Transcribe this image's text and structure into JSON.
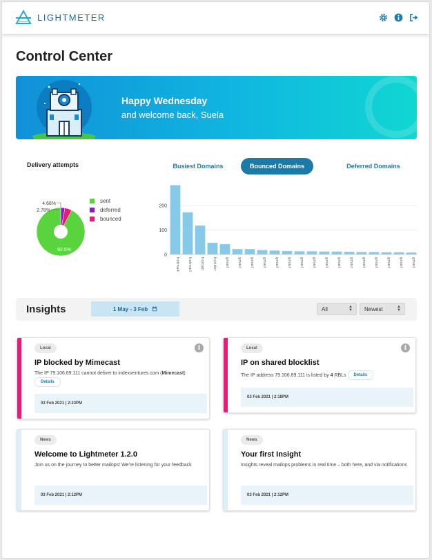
{
  "app": {
    "name": "LIGHTMETER"
  },
  "header": {
    "icons": [
      "gear-icon",
      "info-icon",
      "logout-icon"
    ]
  },
  "page": {
    "title": "Control Center"
  },
  "banner": {
    "greeting": "Happy Wednesday",
    "welcome": "and welcome back, Suela"
  },
  "delivery": {
    "title": "Delivery attempts",
    "legend": [
      {
        "label": "sent",
        "color": "#5ad43d"
      },
      {
        "label": "deferred",
        "color": "#8b1cc4"
      },
      {
        "label": "bounced",
        "color": "#ea1a78"
      }
    ],
    "labels": {
      "sent": "92.5%",
      "deferred": "2.78%",
      "bounced": "4.68%"
    }
  },
  "tabs": [
    {
      "label": "Busiest Domains",
      "active": false
    },
    {
      "label": "Bounced Domains",
      "active": true
    },
    {
      "label": "Deferred Domains",
      "active": false
    }
  ],
  "chart_data": [
    {
      "type": "pie",
      "title": "Delivery attempts",
      "categories": [
        "sent",
        "deferred",
        "bounced"
      ],
      "values": [
        92.5,
        2.78,
        4.68
      ],
      "colors": [
        "#5ad43d",
        "#8b1cc4",
        "#ea1a78"
      ],
      "legend": "right"
    },
    {
      "type": "bar",
      "title": "Bounced Domains",
      "categories": [
        "hotma4",
        "hotmail",
        "homail",
        "hunder",
        "gmail",
        "gmail",
        "gmail",
        "gmail",
        "gmail",
        "gmail",
        "gmail",
        "gmail",
        "gmail",
        "gmail",
        "gmail",
        "gmail",
        "gmail",
        "gmail",
        "gmail",
        "gmail"
      ],
      "values": [
        283,
        172,
        118,
        48,
        42,
        22,
        22,
        18,
        16,
        14,
        13,
        13,
        12,
        12,
        11,
        10,
        10,
        9,
        9,
        8
      ],
      "yticks": [
        0,
        100,
        200
      ],
      "ylim": [
        0,
        290
      ],
      "color": "#86c9e8",
      "grid": true
    }
  ],
  "insights": {
    "title": "Insights",
    "date_range": "1 May - 3 Feb",
    "filter_select": "All",
    "sort_select": "Newest",
    "cards": [
      {
        "tag": "Local",
        "title": "IP blocked by Mimecast",
        "desc_prefix": "The IP 79.106.69.111 cannot deliver to indexventures.com (",
        "desc_bold": "Mimecast",
        "desc_suffix": ")",
        "details_label": "Details",
        "time": "03 Feb 2021 | 2:23PM",
        "stripe": "#ea1a78",
        "has_info": true
      },
      {
        "tag": "Local",
        "title": "IP on shared blocklist",
        "desc_prefix": "The IP address 79.106.69.111 is listed by ",
        "desc_bold": "4",
        "desc_suffix": " RBLs",
        "details_label": "Details",
        "time": "03 Feb 2021 | 2:18PM",
        "stripe": "#ea1a78",
        "has_info": true
      },
      {
        "tag": "News",
        "title": "Welcome to Lightmeter 1.2.0",
        "desc": "Join us on the journey to better mailops! We're listening for your feedback",
        "time": "03 Feb 2021 | 2:12PM",
        "stripe": "#dceef7",
        "has_info": false
      },
      {
        "tag": "News",
        "title": "Your first Insight",
        "desc": "Insights reveal mailops problems in real time – both here, and via notifications",
        "time": "03 Feb 2021 | 2:12PM",
        "stripe": "#dceef7",
        "has_info": false
      }
    ]
  }
}
